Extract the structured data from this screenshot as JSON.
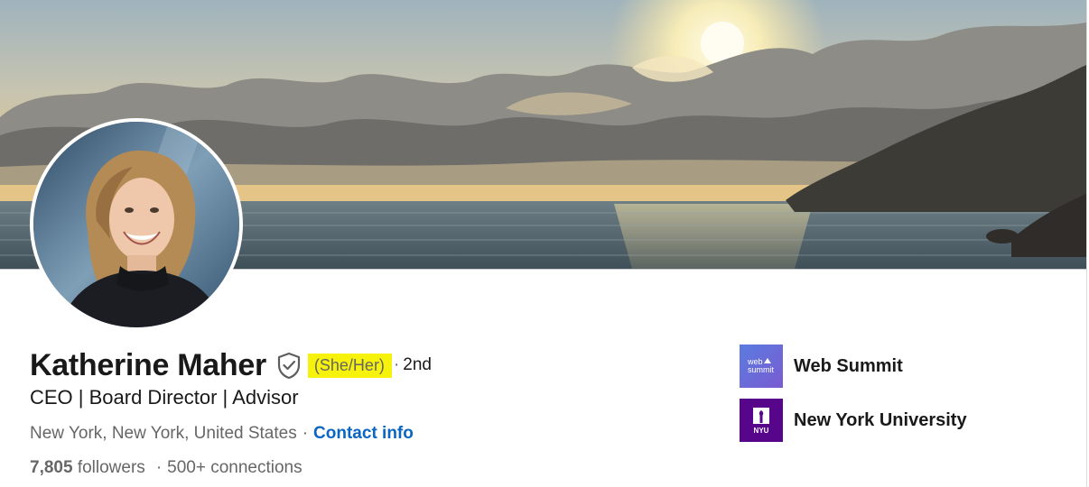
{
  "profile": {
    "name": "Katherine Maher",
    "pronouns": "(She/Her)",
    "degree_separator": "·",
    "degree": "2nd",
    "headline": "CEO | Board Director | Advisor",
    "location": "New York, New York, United States",
    "location_separator": "·",
    "contact_label": "Contact info",
    "followers_count": "7,805",
    "followers_label": "followers",
    "stats_separator": "·",
    "connections_label": "500+ connections"
  },
  "organizations": [
    {
      "name": "Web Summit",
      "logo_text": "web summit",
      "logo_color": "#6c6ad6",
      "icon": "web-summit-logo"
    },
    {
      "name": "New York University",
      "logo_text": "NYU",
      "logo_color": "#57068c",
      "icon": "nyu-torch-logo"
    }
  ],
  "icons": {
    "verification": "shield-check-icon"
  },
  "colors": {
    "link": "#0a66c2",
    "pronoun_highlight": "#f7f20b",
    "secondary_text": "#666666"
  }
}
